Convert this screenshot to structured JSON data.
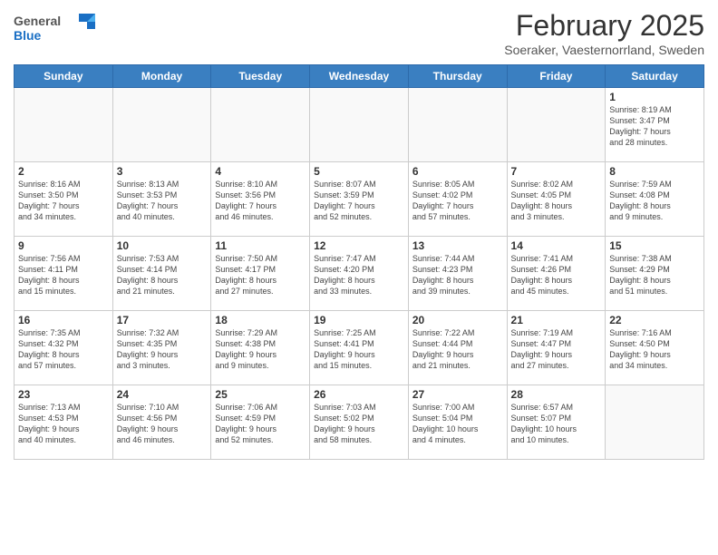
{
  "header": {
    "logo_general": "General",
    "logo_blue": "Blue",
    "month_title": "February 2025",
    "location": "Soeraker, Vaesternorrland, Sweden"
  },
  "days_of_week": [
    "Sunday",
    "Monday",
    "Tuesday",
    "Wednesday",
    "Thursday",
    "Friday",
    "Saturday"
  ],
  "weeks": [
    [
      {
        "day": "",
        "info": ""
      },
      {
        "day": "",
        "info": ""
      },
      {
        "day": "",
        "info": ""
      },
      {
        "day": "",
        "info": ""
      },
      {
        "day": "",
        "info": ""
      },
      {
        "day": "",
        "info": ""
      },
      {
        "day": "1",
        "info": "Sunrise: 8:19 AM\nSunset: 3:47 PM\nDaylight: 7 hours\nand 28 minutes."
      }
    ],
    [
      {
        "day": "2",
        "info": "Sunrise: 8:16 AM\nSunset: 3:50 PM\nDaylight: 7 hours\nand 34 minutes."
      },
      {
        "day": "3",
        "info": "Sunrise: 8:13 AM\nSunset: 3:53 PM\nDaylight: 7 hours\nand 40 minutes."
      },
      {
        "day": "4",
        "info": "Sunrise: 8:10 AM\nSunset: 3:56 PM\nDaylight: 7 hours\nand 46 minutes."
      },
      {
        "day": "5",
        "info": "Sunrise: 8:07 AM\nSunset: 3:59 PM\nDaylight: 7 hours\nand 52 minutes."
      },
      {
        "day": "6",
        "info": "Sunrise: 8:05 AM\nSunset: 4:02 PM\nDaylight: 7 hours\nand 57 minutes."
      },
      {
        "day": "7",
        "info": "Sunrise: 8:02 AM\nSunset: 4:05 PM\nDaylight: 8 hours\nand 3 minutes."
      },
      {
        "day": "8",
        "info": "Sunrise: 7:59 AM\nSunset: 4:08 PM\nDaylight: 8 hours\nand 9 minutes."
      }
    ],
    [
      {
        "day": "9",
        "info": "Sunrise: 7:56 AM\nSunset: 4:11 PM\nDaylight: 8 hours\nand 15 minutes."
      },
      {
        "day": "10",
        "info": "Sunrise: 7:53 AM\nSunset: 4:14 PM\nDaylight: 8 hours\nand 21 minutes."
      },
      {
        "day": "11",
        "info": "Sunrise: 7:50 AM\nSunset: 4:17 PM\nDaylight: 8 hours\nand 27 minutes."
      },
      {
        "day": "12",
        "info": "Sunrise: 7:47 AM\nSunset: 4:20 PM\nDaylight: 8 hours\nand 33 minutes."
      },
      {
        "day": "13",
        "info": "Sunrise: 7:44 AM\nSunset: 4:23 PM\nDaylight: 8 hours\nand 39 minutes."
      },
      {
        "day": "14",
        "info": "Sunrise: 7:41 AM\nSunset: 4:26 PM\nDaylight: 8 hours\nand 45 minutes."
      },
      {
        "day": "15",
        "info": "Sunrise: 7:38 AM\nSunset: 4:29 PM\nDaylight: 8 hours\nand 51 minutes."
      }
    ],
    [
      {
        "day": "16",
        "info": "Sunrise: 7:35 AM\nSunset: 4:32 PM\nDaylight: 8 hours\nand 57 minutes."
      },
      {
        "day": "17",
        "info": "Sunrise: 7:32 AM\nSunset: 4:35 PM\nDaylight: 9 hours\nand 3 minutes."
      },
      {
        "day": "18",
        "info": "Sunrise: 7:29 AM\nSunset: 4:38 PM\nDaylight: 9 hours\nand 9 minutes."
      },
      {
        "day": "19",
        "info": "Sunrise: 7:25 AM\nSunset: 4:41 PM\nDaylight: 9 hours\nand 15 minutes."
      },
      {
        "day": "20",
        "info": "Sunrise: 7:22 AM\nSunset: 4:44 PM\nDaylight: 9 hours\nand 21 minutes."
      },
      {
        "day": "21",
        "info": "Sunrise: 7:19 AM\nSunset: 4:47 PM\nDaylight: 9 hours\nand 27 minutes."
      },
      {
        "day": "22",
        "info": "Sunrise: 7:16 AM\nSunset: 4:50 PM\nDaylight: 9 hours\nand 34 minutes."
      }
    ],
    [
      {
        "day": "23",
        "info": "Sunrise: 7:13 AM\nSunset: 4:53 PM\nDaylight: 9 hours\nand 40 minutes."
      },
      {
        "day": "24",
        "info": "Sunrise: 7:10 AM\nSunset: 4:56 PM\nDaylight: 9 hours\nand 46 minutes."
      },
      {
        "day": "25",
        "info": "Sunrise: 7:06 AM\nSunset: 4:59 PM\nDaylight: 9 hours\nand 52 minutes."
      },
      {
        "day": "26",
        "info": "Sunrise: 7:03 AM\nSunset: 5:02 PM\nDaylight: 9 hours\nand 58 minutes."
      },
      {
        "day": "27",
        "info": "Sunrise: 7:00 AM\nSunset: 5:04 PM\nDaylight: 10 hours\nand 4 minutes."
      },
      {
        "day": "28",
        "info": "Sunrise: 6:57 AM\nSunset: 5:07 PM\nDaylight: 10 hours\nand 10 minutes."
      },
      {
        "day": "",
        "info": ""
      }
    ]
  ]
}
